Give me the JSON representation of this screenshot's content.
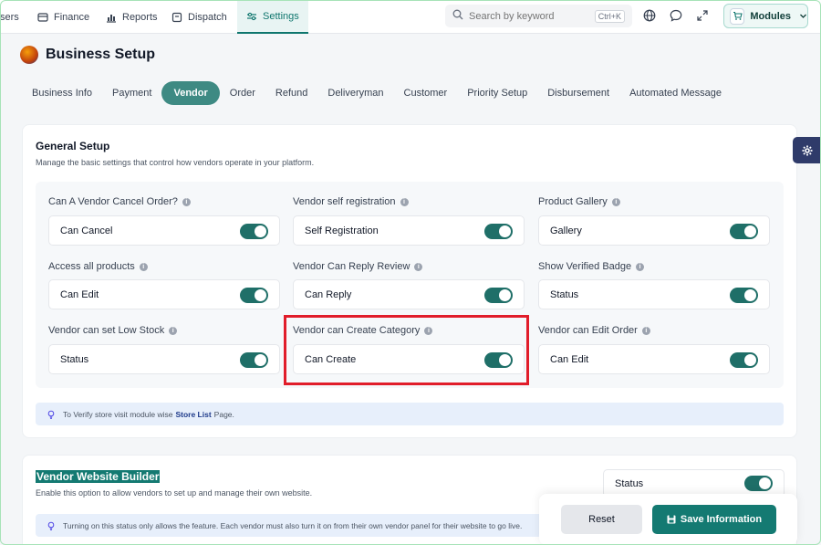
{
  "topnav": {
    "items": [
      {
        "label": "sers",
        "icon": "users-icon"
      },
      {
        "label": "Finance",
        "icon": "finance-icon"
      },
      {
        "label": "Reports",
        "icon": "reports-icon"
      },
      {
        "label": "Dispatch",
        "icon": "dispatch-icon"
      },
      {
        "label": "Settings",
        "icon": "settings-icon"
      }
    ],
    "search_placeholder": "Search by keyword",
    "search_shortcut": "Ctrl+K",
    "modules_label": "Modules"
  },
  "page": {
    "title": "Business Setup"
  },
  "tabs": [
    "Business Info",
    "Payment",
    "Vendor",
    "Order",
    "Refund",
    "Deliveryman",
    "Customer",
    "Priority Setup",
    "Disbursement",
    "Automated Message"
  ],
  "active_tab": "Vendor",
  "general_setup": {
    "title": "General Setup",
    "subtitle": "Manage the basic settings that control how vendors operate in your platform.",
    "fields": [
      {
        "label": "Can A Vendor Cancel Order?",
        "toggle_label": "Can Cancel",
        "enabled": true
      },
      {
        "label": "Vendor self registration",
        "toggle_label": "Self Registration",
        "enabled": true
      },
      {
        "label": "Product Gallery",
        "toggle_label": "Gallery",
        "enabled": true
      },
      {
        "label": "Access all products",
        "toggle_label": "Can Edit",
        "enabled": true
      },
      {
        "label": "Vendor Can Reply Review",
        "toggle_label": "Can Reply",
        "enabled": true
      },
      {
        "label": "Show Verified Badge",
        "toggle_label": "Status",
        "enabled": true
      },
      {
        "label": "Vendor can set Low Stock",
        "toggle_label": "Status",
        "enabled": true
      },
      {
        "label": "Vendor can Create Category",
        "toggle_label": "Can Create",
        "enabled": true
      },
      {
        "label": "Vendor can Edit Order",
        "toggle_label": "Can Edit",
        "enabled": true
      }
    ],
    "note_prefix": "To Verify store visit module wise",
    "note_link": "Store List",
    "note_suffix": "Page."
  },
  "website_builder": {
    "title": "Vendor Website Builder",
    "subtitle": "Enable this option to allow vendors to set up and manage their own website.",
    "status_label": "Status",
    "enabled": true,
    "note": "Turning on this status only allows the feature. Each vendor must also turn it on from their own vendor panel for their website to go live."
  },
  "actions": {
    "reset": "Reset",
    "save": "Save Information"
  },
  "colors": {
    "primary": "#147a72",
    "tab_active": "#3e8a83",
    "highlight": "#e11d2a"
  }
}
